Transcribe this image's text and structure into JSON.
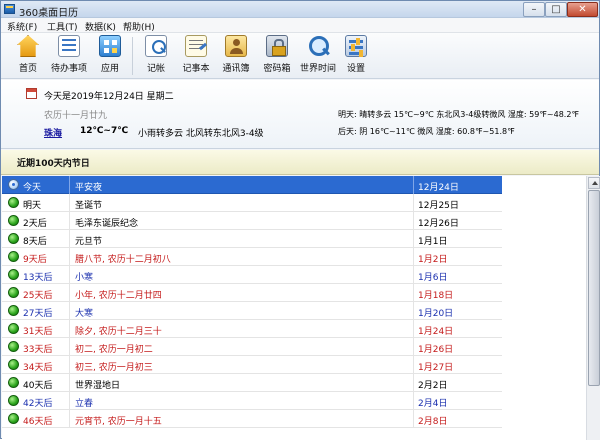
{
  "window": {
    "title": "360桌面日历",
    "min_glyph": "–",
    "max_glyph": "□",
    "close_glyph": "✕"
  },
  "menu": [
    "系统(F)",
    "工具(T)",
    "数据(K)",
    "帮助(H)"
  ],
  "toolbar": [
    {
      "label": "首页",
      "icon": "home-icon"
    },
    {
      "label": "待办事项",
      "icon": "todo-icon"
    },
    {
      "label": "应用",
      "icon": "apps-icon"
    },
    {
      "label": "记帐",
      "icon": "account-icon"
    },
    {
      "label": "记事本",
      "icon": "notes-icon"
    },
    {
      "label": "通讯簿",
      "icon": "contacts-icon"
    },
    {
      "label": "密码箱",
      "icon": "password-icon"
    },
    {
      "label": "世界时间",
      "icon": "world-time-icon"
    },
    {
      "label": "设置",
      "icon": "settings-icon"
    }
  ],
  "today": {
    "date_line": "今天是2019年12月24日   星期二",
    "lunar": "农历十一月廿九",
    "city": "珠海",
    "temp": "12℃~7℃",
    "weather": "小雨转多云   北风转东北风3-4级",
    "tomorrow": "明天: 晴转多云  15℃~9℃  东北风3-4级转微风  湿度: 59℉~48.2℉",
    "day_after": "后天: 阴  16℃~11℃  微风  湿度: 60.8℉~51.8℉"
  },
  "section_title": "近期100天内节日",
  "holidays": [
    {
      "when": "今天",
      "name": "平安夜",
      "date": "12月24日",
      "style": "head"
    },
    {
      "when": "明天",
      "name": "圣诞节",
      "date": "12月25日",
      "style": "black"
    },
    {
      "when": "2天后",
      "name": "毛泽东诞辰纪念",
      "date": "12月26日",
      "style": "black"
    },
    {
      "when": "8天后",
      "name": "元旦节",
      "date": "1月1日",
      "style": "black"
    },
    {
      "when": "9天后",
      "name": "腊八节, 农历十二月初八",
      "date": "1月2日",
      "style": "red"
    },
    {
      "when": "13天后",
      "name": "小寒",
      "date": "1月6日",
      "style": "blue"
    },
    {
      "when": "25天后",
      "name": "小年, 农历十二月廿四",
      "date": "1月18日",
      "style": "red"
    },
    {
      "when": "27天后",
      "name": "大寒",
      "date": "1月20日",
      "style": "blue"
    },
    {
      "when": "31天后",
      "name": "除夕, 农历十二月三十",
      "date": "1月24日",
      "style": "red"
    },
    {
      "when": "33天后",
      "name": "初二, 农历一月初二",
      "date": "1月26日",
      "style": "red"
    },
    {
      "when": "34天后",
      "name": "初三, 农历一月初三",
      "date": "1月27日",
      "style": "red"
    },
    {
      "when": "40天后",
      "name": "世界湿地日",
      "date": "2月2日",
      "style": "black"
    },
    {
      "when": "42天后",
      "name": "立春",
      "date": "2月4日",
      "style": "blue"
    },
    {
      "when": "46天后",
      "name": "元宵节, 农历一月十五",
      "date": "2月8日",
      "style": "red"
    }
  ]
}
